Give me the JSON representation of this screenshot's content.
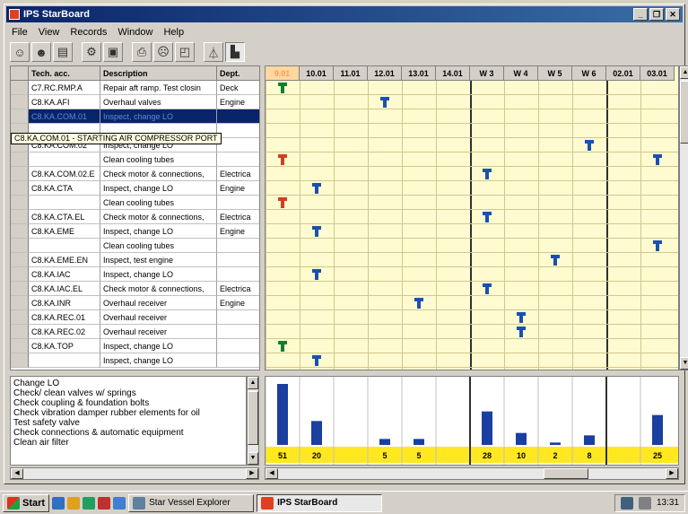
{
  "window": {
    "title": "IPS StarBoard"
  },
  "menu": [
    "File",
    "View",
    "Records",
    "Window",
    "Help"
  ],
  "table": {
    "headers": {
      "tech": "Tech. acc.",
      "desc": "Description",
      "dept": "Dept."
    },
    "rows": [
      {
        "tech": "C7.RC.RMP.A",
        "desc": "Repair aft ramp. Test closin",
        "dept": "Deck"
      },
      {
        "tech": "C8.KA.AFI",
        "desc": "Overhaul valves",
        "dept": "Engine"
      },
      {
        "tech": "C8.KA.COM.01",
        "desc": "Inspect, change LO",
        "dept": ""
      },
      {
        "tech": "",
        "desc": "",
        "dept": ""
      },
      {
        "tech": "C8.KA.COM.02",
        "desc": "Inspect, change LO",
        "dept": ""
      },
      {
        "tech": "",
        "desc": "Clean cooling tubes",
        "dept": ""
      },
      {
        "tech": "C8.KA.COM.02.E",
        "desc": "Check motor & connections,",
        "dept": "Electrica"
      },
      {
        "tech": "C8.KA.CTA",
        "desc": "Inspect, change LO",
        "dept": "Engine"
      },
      {
        "tech": "",
        "desc": "Clean cooling tubes",
        "dept": ""
      },
      {
        "tech": "C8.KA.CTA.EL",
        "desc": "Check motor & connections,",
        "dept": "Electrica"
      },
      {
        "tech": "C8.KA.EME",
        "desc": "Inspect, change LO",
        "dept": "Engine"
      },
      {
        "tech": "",
        "desc": "Clean cooling tubes",
        "dept": ""
      },
      {
        "tech": "C8.KA.EME.EN",
        "desc": "Inspect, test engine",
        "dept": ""
      },
      {
        "tech": "C8.KA.IAC",
        "desc": "Inspect, change LO",
        "dept": ""
      },
      {
        "tech": "C8.KA.IAC.EL",
        "desc": "Check motor & connections,",
        "dept": "Electrica"
      },
      {
        "tech": "C8.KA.INR",
        "desc": "Overhaul receiver",
        "dept": "Engine"
      },
      {
        "tech": "C8.KA.REC.01",
        "desc": "Overhaul receiver",
        "dept": ""
      },
      {
        "tech": "C8.KA.REC.02",
        "desc": "Overhaul receiver",
        "dept": ""
      },
      {
        "tech": "C8.KA.TOP",
        "desc": "Inspect, change LO",
        "dept": ""
      },
      {
        "tech": "",
        "desc": "Inspect, change LO",
        "dept": ""
      }
    ]
  },
  "tooltip": "C8.KA.COM.01 - STARTING AIR COMPRESSOR PORT",
  "timeline": {
    "columns": [
      "9.01",
      "10.01",
      "11.01",
      "12.01",
      "13.01",
      "14.01",
      "W 3",
      "W 4",
      "W 5",
      "W 6",
      "02.01",
      "03.01"
    ],
    "markers": [
      {
        "row": 0,
        "col": 0,
        "color": "green"
      },
      {
        "row": 1,
        "col": 3,
        "color": "blue"
      },
      {
        "row": 4,
        "col": 9,
        "color": "blue"
      },
      {
        "row": 5,
        "col": 0,
        "color": "red"
      },
      {
        "row": 5,
        "col": 11,
        "color": "blue"
      },
      {
        "row": 6,
        "col": 6,
        "color": "blue"
      },
      {
        "row": 7,
        "col": 1,
        "color": "blue"
      },
      {
        "row": 8,
        "col": 0,
        "color": "red"
      },
      {
        "row": 9,
        "col": 6,
        "color": "blue"
      },
      {
        "row": 10,
        "col": 1,
        "color": "blue"
      },
      {
        "row": 11,
        "col": 11,
        "color": "blue"
      },
      {
        "row": 12,
        "col": 8,
        "color": "blue"
      },
      {
        "row": 13,
        "col": 1,
        "color": "blue"
      },
      {
        "row": 14,
        "col": 6,
        "color": "blue"
      },
      {
        "row": 15,
        "col": 4,
        "color": "blue"
      },
      {
        "row": 16,
        "col": 7,
        "color": "blue"
      },
      {
        "row": 17,
        "col": 7,
        "color": "blue"
      },
      {
        "row": 18,
        "col": 0,
        "color": "green"
      },
      {
        "row": 19,
        "col": 1,
        "color": "blue"
      }
    ]
  },
  "notes": [
    "Change LO",
    "Check/ clean valves w/ springs",
    "Check coupling & foundation bolts",
    "Check vibration damper rubber elements for oil",
    "Test safety valve",
    "Check connections & automatic equipment",
    "Clean air filter"
  ],
  "chart_data": {
    "type": "bar",
    "categories": [
      "9.01",
      "10.01",
      "11.01",
      "12.01",
      "13.01",
      "14.01",
      "W 3",
      "W 4",
      "W 5",
      "W 6",
      "02.01",
      "03.01"
    ],
    "values": [
      51,
      20,
      0,
      5,
      5,
      0,
      28,
      10,
      2,
      8,
      0,
      25
    ],
    "labels": [
      "51",
      "20",
      "",
      "5",
      "5",
      "",
      "28",
      "10",
      "2",
      "8",
      "",
      "25"
    ],
    "ylim": [
      0,
      51
    ],
    "bar_color": "#1a3fa0",
    "label_band_color": "#ffe820"
  },
  "taskbar": {
    "start": "Start",
    "tasks": [
      {
        "label": "Star Vessel Explorer",
        "active": false
      },
      {
        "label": "IPS StarBoard",
        "active": true
      }
    ],
    "clock": "13:31"
  },
  "colors": {
    "title": "#0a246a",
    "grid": "#fffbd0",
    "blue": "#1a50b0",
    "green": "#108030",
    "red": "#d04020"
  }
}
